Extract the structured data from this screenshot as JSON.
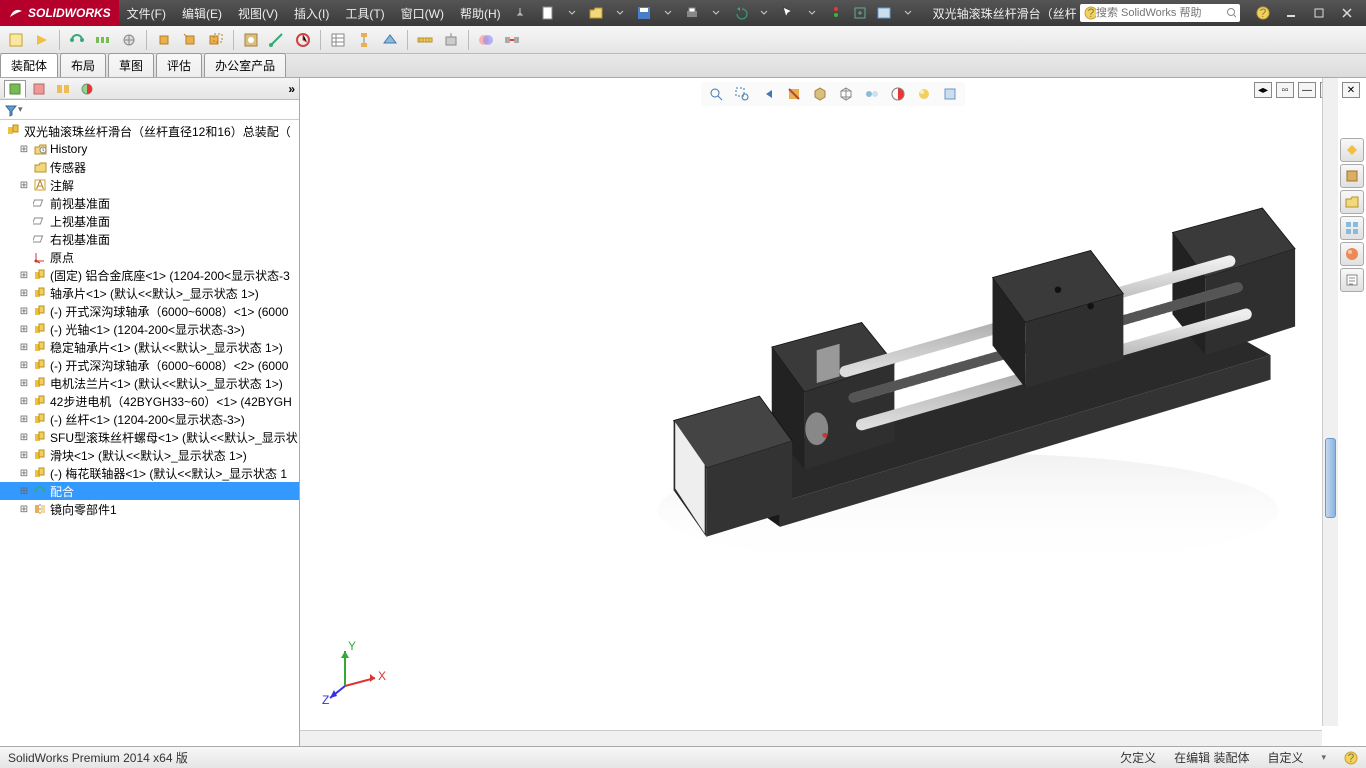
{
  "logo_text": "SOLIDWORKS",
  "menus": [
    "文件(F)",
    "编辑(E)",
    "视图(V)",
    "插入(I)",
    "工具(T)",
    "窗口(W)",
    "帮助(H)"
  ],
  "doc_title": "双光轴滚珠丝杆滑台（丝杆直径...",
  "search": {
    "placeholder": "搜索 SolidWorks 帮助"
  },
  "cmd_tabs": [
    "装配体",
    "布局",
    "草图",
    "评估",
    "办公室产品"
  ],
  "tree_root": "双光轴滚珠丝杆滑台（丝杆直径12和16）总装配（",
  "tree": [
    {
      "icon": "history",
      "label": "History"
    },
    {
      "icon": "folder",
      "label": "传感器"
    },
    {
      "icon": "annot",
      "label": "注解"
    },
    {
      "icon": "plane",
      "label": "前视基准面"
    },
    {
      "icon": "plane",
      "label": "上视基准面"
    },
    {
      "icon": "plane",
      "label": "右视基准面"
    },
    {
      "icon": "origin",
      "label": "原点"
    },
    {
      "icon": "part",
      "label": "(固定) 铝合金底座<1> (1204-200<显示状态-3"
    },
    {
      "icon": "part",
      "label": "轴承片<1> (默认<<默认>_显示状态 1>)"
    },
    {
      "icon": "part",
      "label": "(-) 开式深沟球轴承（6000~6008）<1> (6000"
    },
    {
      "icon": "part",
      "label": "(-) 光轴<1> (1204-200<显示状态-3>)"
    },
    {
      "icon": "part",
      "label": "稳定轴承片<1> (默认<<默认>_显示状态 1>)"
    },
    {
      "icon": "part",
      "label": "(-) 开式深沟球轴承（6000~6008）<2> (6000"
    },
    {
      "icon": "part",
      "label": "电机法兰片<1> (默认<<默认>_显示状态 1>)"
    },
    {
      "icon": "part",
      "label": "42步进电机（42BYGH33~60）<1> (42BYGH"
    },
    {
      "icon": "part",
      "label": "(-) 丝杆<1> (1204-200<显示状态-3>)"
    },
    {
      "icon": "part",
      "label": "SFU型滚珠丝杆螺母<1> (默认<<默认>_显示状"
    },
    {
      "icon": "part",
      "label": "滑块<1> (默认<<默认>_显示状态 1>)"
    },
    {
      "icon": "part",
      "label": "(-) 梅花联轴器<1> (默认<<默认>_显示状态 1"
    },
    {
      "icon": "mates",
      "label": "配合",
      "selected": true
    },
    {
      "icon": "mirror",
      "label": "镜向零部件1"
    }
  ],
  "triad": {
    "x": "X",
    "y": "Y",
    "z": "Z"
  },
  "status": {
    "left": "SolidWorks Premium 2014 x64 版",
    "s1": "欠定义",
    "s2": "在编辑 装配体",
    "s3": "自定义"
  }
}
